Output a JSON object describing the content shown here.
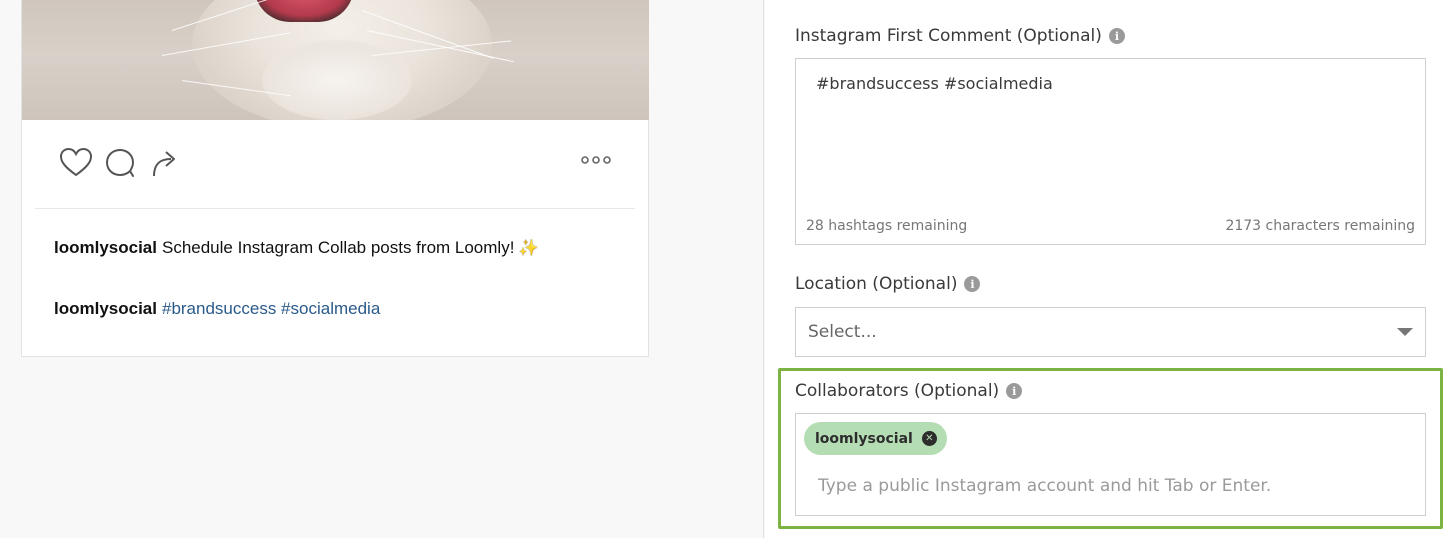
{
  "preview": {
    "username": "loomlysocial",
    "caption": "Schedule Instagram Collab posts from Loomly!",
    "caption_emoji": "✨",
    "comment_username": "loomlysocial",
    "comment_tags": "#brandsuccess #socialmedia",
    "icons": {
      "like": "heart-icon",
      "comment": "comment-icon",
      "share": "share-icon",
      "more": "more-options-icon"
    }
  },
  "form": {
    "first_comment": {
      "label": "Instagram First Comment (Optional)",
      "value": "#brandsuccess #socialmedia",
      "hashtags_remaining": "28 hashtags remaining",
      "characters_remaining": "2173 characters remaining"
    },
    "location": {
      "label": "Location (Optional)",
      "placeholder": "Select..."
    },
    "collaborators": {
      "label": "Collaborators (Optional)",
      "tags": [
        "loomlysocial"
      ],
      "placeholder": "Type a public Instagram account and hit Tab or Enter."
    }
  },
  "colors": {
    "highlight": "#7cb342",
    "tag_background": "#b5ddb4",
    "hashtag_link": "#2a5a8a"
  }
}
